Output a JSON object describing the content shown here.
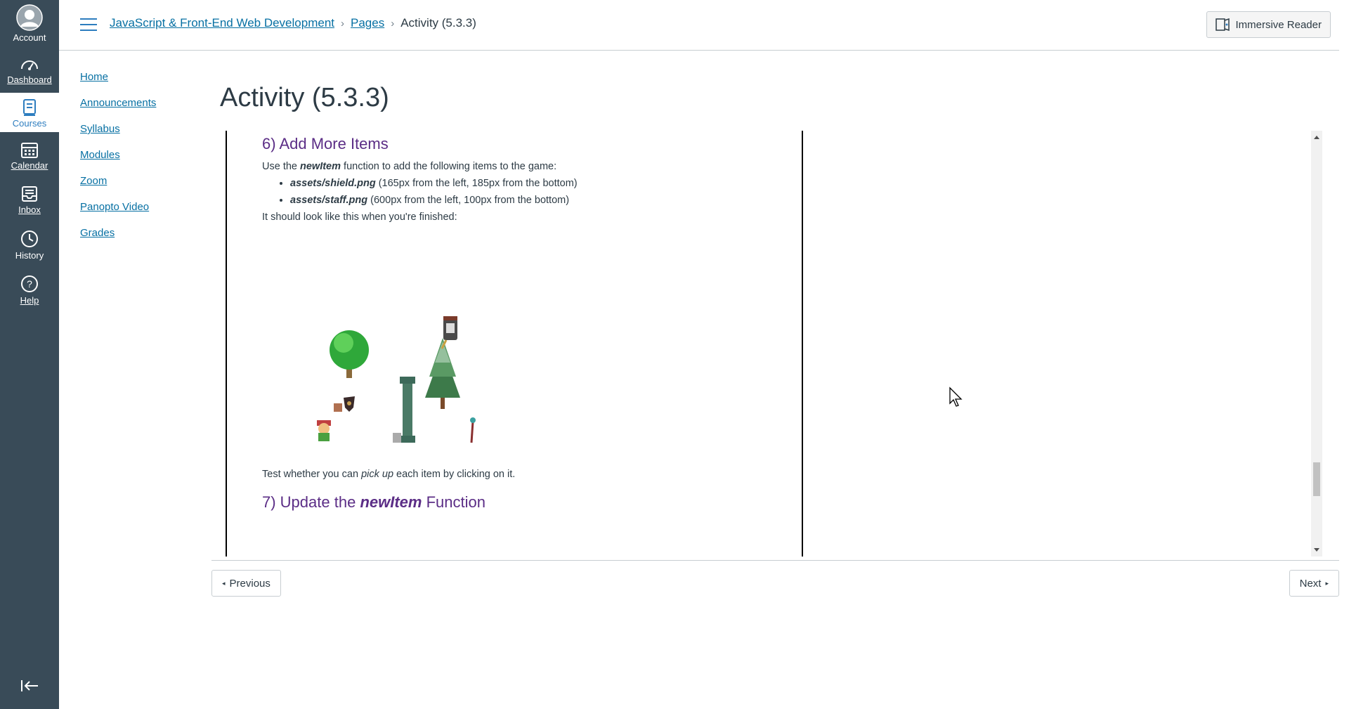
{
  "global_nav": {
    "account": "Account",
    "dashboard": "Dashboard",
    "courses": "Courses",
    "calendar": "Calendar",
    "inbox": "Inbox",
    "history": "History",
    "help": "Help"
  },
  "breadcrumbs": {
    "course": "JavaScript & Front-End Web Development",
    "sep": "›",
    "pages": "Pages",
    "current": "Activity (5.3.3)"
  },
  "header": {
    "immersive_reader": "Immersive Reader"
  },
  "course_nav": {
    "items": [
      "Home",
      "Announcements",
      "Syllabus",
      "Modules",
      "Zoom",
      "Panopto Video",
      "Grades"
    ]
  },
  "page": {
    "title": "Activity (5.3.3)",
    "section6_heading": "6) Add More Items",
    "intro_pre": "Use the ",
    "intro_fn": "newItem",
    "intro_post": " function to add the following items to the game:",
    "items": [
      {
        "file": "assets/shield.png",
        "desc": " (165px from the left, 185px from the bottom)"
      },
      {
        "file": "assets/staff.png",
        "desc": " (600px from the left, 100px from the bottom)"
      }
    ],
    "finished_text": "It should look like this when you're finished:",
    "test_pre": "Test whether you can ",
    "test_em": "pick up",
    "test_post": " each item by clicking on it.",
    "section7_pre": "7) Update the ",
    "section7_fn": "newItem",
    "section7_post": " Function"
  },
  "pager": {
    "previous": "Previous",
    "next": "Next"
  },
  "colors": {
    "nav_bg": "#394b58",
    "link": "#0770a3",
    "heading": "#5b2d86"
  }
}
